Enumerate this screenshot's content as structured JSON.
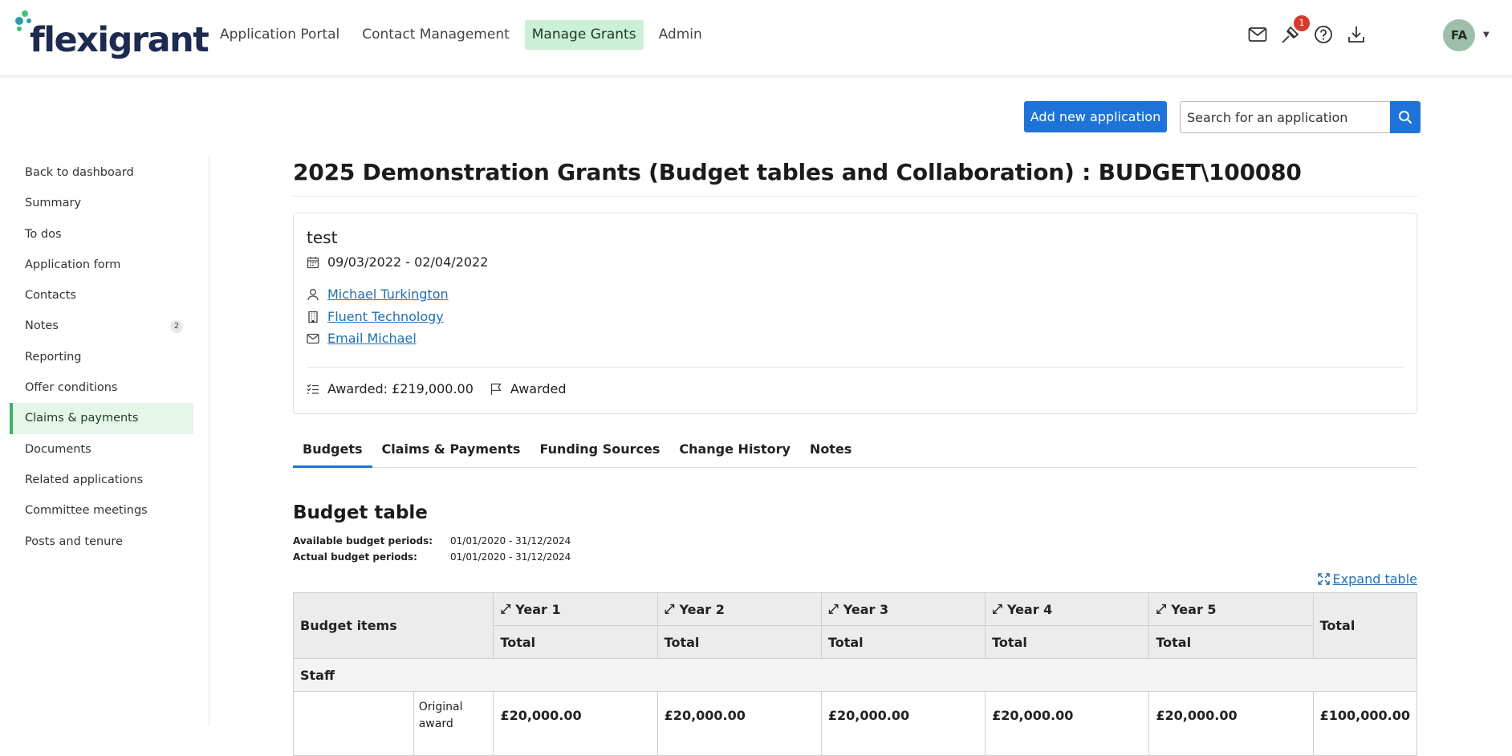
{
  "brand": {
    "name": "flexigrant"
  },
  "nav": {
    "items": [
      "Application Portal",
      "Contact Management",
      "Manage Grants",
      "Admin"
    ],
    "active": "Manage Grants"
  },
  "top_icons": {
    "notifications_count": "1",
    "avatar_initials": "FA"
  },
  "actions": {
    "add_label": "Add new application",
    "search_placeholder": "Search for an application"
  },
  "sidebar": {
    "items": [
      {
        "label": "Back to dashboard"
      },
      {
        "label": "Summary"
      },
      {
        "label": "To dos"
      },
      {
        "label": "Application form"
      },
      {
        "label": "Contacts"
      },
      {
        "label": "Notes",
        "count": "2"
      },
      {
        "label": "Reporting"
      },
      {
        "label": "Offer conditions"
      },
      {
        "label": "Claims & payments"
      },
      {
        "label": "Documents"
      },
      {
        "label": "Related applications"
      },
      {
        "label": "Committee meetings"
      },
      {
        "label": "Posts and tenure"
      }
    ],
    "active": "Claims & payments"
  },
  "page": {
    "title": "2025 Demonstration Grants (Budget tables and Collaboration) : BUDGET\\100080"
  },
  "summary": {
    "name": "test",
    "dates": "09/03/2022 - 02/04/2022",
    "contact": "Michael Turkington",
    "organisation": "Fluent Technology",
    "email": "Email Michael",
    "awarded_amount": "Awarded: £219,000.00",
    "status": "Awarded"
  },
  "tabs": [
    "Budgets",
    "Claims & Payments",
    "Funding Sources",
    "Change History",
    "Notes"
  ],
  "budget": {
    "title": "Budget table",
    "available_label": "Available budget periods:",
    "available_value": "01/01/2020 - 31/12/2024",
    "actual_label": "Actual budget periods:",
    "actual_value": "01/01/2020 - 31/12/2024",
    "expand_label": "Expand table",
    "items_header": "Budget items",
    "years": [
      "Year 1",
      "Year 2",
      "Year 3",
      "Year 4",
      "Year 5"
    ],
    "sub_header": "Total",
    "total_header": "Total",
    "section": "Staff",
    "row_note": "Original award",
    "row_values": [
      "£20,000.00",
      "£20,000.00",
      "£20,000.00",
      "£20,000.00",
      "£20,000.00"
    ],
    "row_total": "£100,000.00"
  }
}
